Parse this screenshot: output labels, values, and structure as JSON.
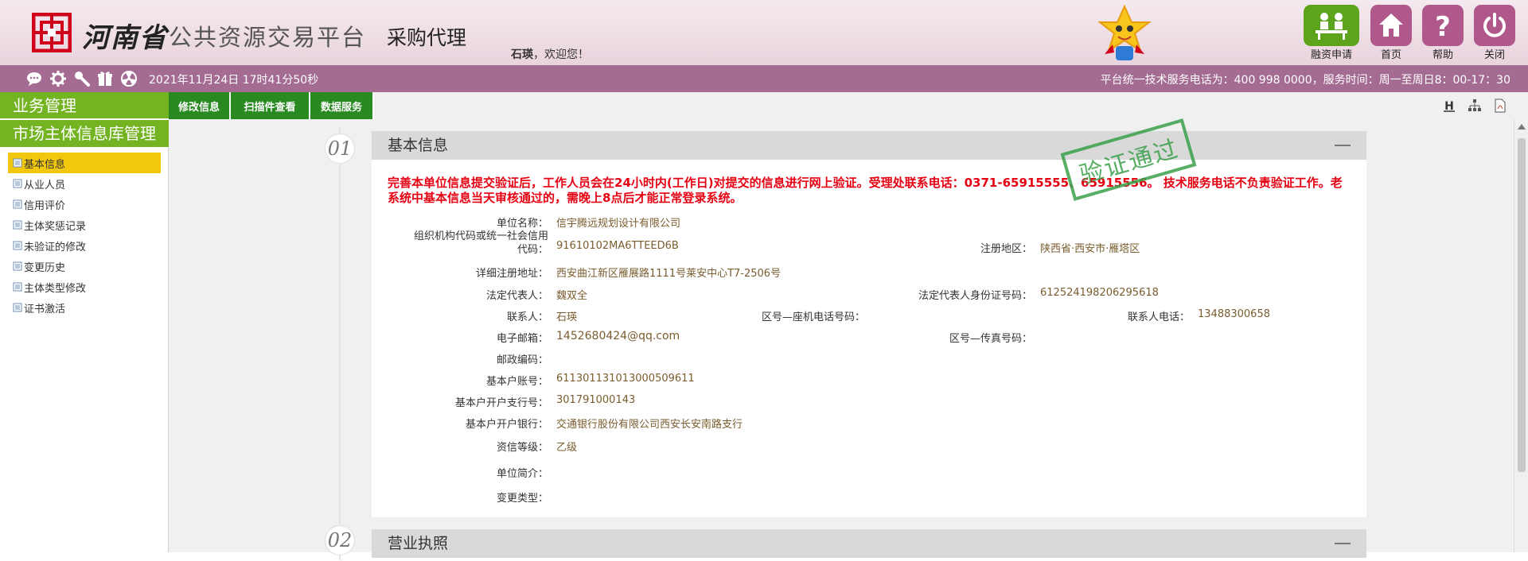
{
  "header": {
    "province": "河南省",
    "platform": "公共资源交易平台",
    "module": "采购代理",
    "user_name": "石瑛",
    "welcome_suffix": "，欢迎您！",
    "buttons": [
      {
        "label": "融资申请",
        "icon": "financing-icon",
        "color": "#5ea31c"
      },
      {
        "label": "首页",
        "icon": "home-icon",
        "color": "#b0578b"
      },
      {
        "label": "帮助",
        "icon": "help-icon",
        "color": "#b0578b"
      },
      {
        "label": "关闭",
        "icon": "power-icon",
        "color": "#b0578b"
      }
    ]
  },
  "statusbar": {
    "icons": [
      "message-icon",
      "gear-icon",
      "tools-icon",
      "gift-icon",
      "radiation-icon"
    ],
    "datetime": "2021年11月24日 17时41分50秒",
    "hotline": "平台统一技术服务电话为：400 998 0000，服务时间：周一至周日8：00-17：30"
  },
  "sidebar": {
    "section1": "业务管理",
    "section2": "市场主体信息库管理",
    "items": [
      {
        "label": "基本信息",
        "active": true
      },
      {
        "label": "从业人员",
        "active": false
      },
      {
        "label": "信用评价",
        "active": false
      },
      {
        "label": "主体奖惩记录",
        "active": false
      },
      {
        "label": "未验证的修改",
        "active": false
      },
      {
        "label": "变更历史",
        "active": false
      },
      {
        "label": "主体类型修改",
        "active": false
      },
      {
        "label": "证书激活",
        "active": false
      }
    ]
  },
  "tabs": [
    "修改信息",
    "扫描件查看",
    "数据服务"
  ],
  "toolbar_icons": [
    "h-icon",
    "org-chart-icon",
    "pdf-icon"
  ],
  "sections": [
    {
      "num": "01",
      "title": "基本信息"
    },
    {
      "num": "02",
      "title": "营业执照"
    }
  ],
  "stamp": "验证通过",
  "notice": "完善本单位信息提交验证后，工作人员会在24小时内(工作日)对提交的信息进行网上验证。受理处联系电话：0371-65915555、65915556。 技术服务电话不负责验证工作。老系统中基本信息当天审核通过的，需晚上8点后才能正常登录系统。",
  "fields": {
    "unit_name": {
      "label": "单位名称：",
      "value": "信宇腾远规划设计有限公司"
    },
    "org_code": {
      "label_line1": "组织机构代码或统一社会信用",
      "label_line2": "代码：",
      "value": "91610102MA6TTEED6B"
    },
    "region": {
      "label": "注册地区：",
      "value": "陕西省·西安市·雁塔区"
    },
    "address": {
      "label": "详细注册地址：",
      "value": "西安曲江新区雁展路1111号莱安中心T7-2506号"
    },
    "legal_rep": {
      "label": "法定代表人：",
      "value": "魏双全"
    },
    "legal_id": {
      "label": "法定代表人身份证号码：",
      "value": "612524198206295618"
    },
    "contact": {
      "label": "联系人：",
      "value": "石瑛"
    },
    "landline": {
      "label": "区号—座机电话号码：",
      "value": ""
    },
    "contact_phone": {
      "label": "联系人电话：",
      "value": "13488300658"
    },
    "email": {
      "label": "电子邮箱：",
      "value": "1452680424@qq.com"
    },
    "fax": {
      "label": "区号—传真号码：",
      "value": ""
    },
    "postcode": {
      "label": "邮政编码：",
      "value": ""
    },
    "account": {
      "label": "基本户账号：",
      "value": "611301131013000509611"
    },
    "branch_no": {
      "label": "基本户开户支行号：",
      "value": "301791000143"
    },
    "bank": {
      "label": "基本户开户银行：",
      "value": "交通银行股份有限公司西安长安南路支行"
    },
    "grade": {
      "label": "资信等级：",
      "value": "乙级"
    },
    "intro": {
      "label": "单位简介：",
      "value": ""
    },
    "change_type": {
      "label": "变更类型：",
      "value": ""
    }
  }
}
